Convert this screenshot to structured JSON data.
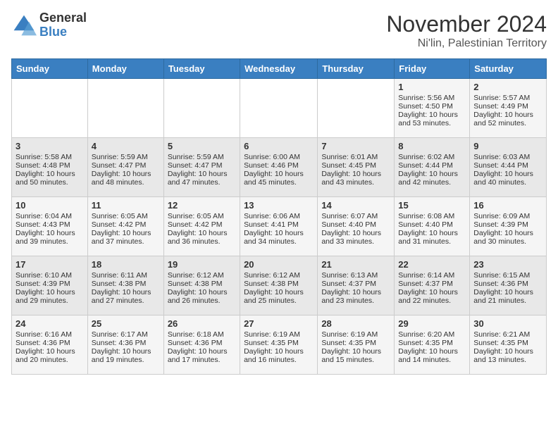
{
  "logo": {
    "general": "General",
    "blue": "Blue"
  },
  "title": "November 2024",
  "subtitle": "Ni'lin, Palestinian Territory",
  "days_of_week": [
    "Sunday",
    "Monday",
    "Tuesday",
    "Wednesday",
    "Thursday",
    "Friday",
    "Saturday"
  ],
  "weeks": [
    [
      {
        "day": "",
        "content": ""
      },
      {
        "day": "",
        "content": ""
      },
      {
        "day": "",
        "content": ""
      },
      {
        "day": "",
        "content": ""
      },
      {
        "day": "",
        "content": ""
      },
      {
        "day": "1",
        "content": "Sunrise: 5:56 AM\nSunset: 4:50 PM\nDaylight: 10 hours and 53 minutes."
      },
      {
        "day": "2",
        "content": "Sunrise: 5:57 AM\nSunset: 4:49 PM\nDaylight: 10 hours and 52 minutes."
      }
    ],
    [
      {
        "day": "3",
        "content": "Sunrise: 5:58 AM\nSunset: 4:48 PM\nDaylight: 10 hours and 50 minutes."
      },
      {
        "day": "4",
        "content": "Sunrise: 5:59 AM\nSunset: 4:47 PM\nDaylight: 10 hours and 48 minutes."
      },
      {
        "day": "5",
        "content": "Sunrise: 5:59 AM\nSunset: 4:47 PM\nDaylight: 10 hours and 47 minutes."
      },
      {
        "day": "6",
        "content": "Sunrise: 6:00 AM\nSunset: 4:46 PM\nDaylight: 10 hours and 45 minutes."
      },
      {
        "day": "7",
        "content": "Sunrise: 6:01 AM\nSunset: 4:45 PM\nDaylight: 10 hours and 43 minutes."
      },
      {
        "day": "8",
        "content": "Sunrise: 6:02 AM\nSunset: 4:44 PM\nDaylight: 10 hours and 42 minutes."
      },
      {
        "day": "9",
        "content": "Sunrise: 6:03 AM\nSunset: 4:44 PM\nDaylight: 10 hours and 40 minutes."
      }
    ],
    [
      {
        "day": "10",
        "content": "Sunrise: 6:04 AM\nSunset: 4:43 PM\nDaylight: 10 hours and 39 minutes."
      },
      {
        "day": "11",
        "content": "Sunrise: 6:05 AM\nSunset: 4:42 PM\nDaylight: 10 hours and 37 minutes."
      },
      {
        "day": "12",
        "content": "Sunrise: 6:05 AM\nSunset: 4:42 PM\nDaylight: 10 hours and 36 minutes."
      },
      {
        "day": "13",
        "content": "Sunrise: 6:06 AM\nSunset: 4:41 PM\nDaylight: 10 hours and 34 minutes."
      },
      {
        "day": "14",
        "content": "Sunrise: 6:07 AM\nSunset: 4:40 PM\nDaylight: 10 hours and 33 minutes."
      },
      {
        "day": "15",
        "content": "Sunrise: 6:08 AM\nSunset: 4:40 PM\nDaylight: 10 hours and 31 minutes."
      },
      {
        "day": "16",
        "content": "Sunrise: 6:09 AM\nSunset: 4:39 PM\nDaylight: 10 hours and 30 minutes."
      }
    ],
    [
      {
        "day": "17",
        "content": "Sunrise: 6:10 AM\nSunset: 4:39 PM\nDaylight: 10 hours and 29 minutes."
      },
      {
        "day": "18",
        "content": "Sunrise: 6:11 AM\nSunset: 4:38 PM\nDaylight: 10 hours and 27 minutes."
      },
      {
        "day": "19",
        "content": "Sunrise: 6:12 AM\nSunset: 4:38 PM\nDaylight: 10 hours and 26 minutes."
      },
      {
        "day": "20",
        "content": "Sunrise: 6:12 AM\nSunset: 4:38 PM\nDaylight: 10 hours and 25 minutes."
      },
      {
        "day": "21",
        "content": "Sunrise: 6:13 AM\nSunset: 4:37 PM\nDaylight: 10 hours and 23 minutes."
      },
      {
        "day": "22",
        "content": "Sunrise: 6:14 AM\nSunset: 4:37 PM\nDaylight: 10 hours and 22 minutes."
      },
      {
        "day": "23",
        "content": "Sunrise: 6:15 AM\nSunset: 4:36 PM\nDaylight: 10 hours and 21 minutes."
      }
    ],
    [
      {
        "day": "24",
        "content": "Sunrise: 6:16 AM\nSunset: 4:36 PM\nDaylight: 10 hours and 20 minutes."
      },
      {
        "day": "25",
        "content": "Sunrise: 6:17 AM\nSunset: 4:36 PM\nDaylight: 10 hours and 19 minutes."
      },
      {
        "day": "26",
        "content": "Sunrise: 6:18 AM\nSunset: 4:36 PM\nDaylight: 10 hours and 17 minutes."
      },
      {
        "day": "27",
        "content": "Sunrise: 6:19 AM\nSunset: 4:35 PM\nDaylight: 10 hours and 16 minutes."
      },
      {
        "day": "28",
        "content": "Sunrise: 6:19 AM\nSunset: 4:35 PM\nDaylight: 10 hours and 15 minutes."
      },
      {
        "day": "29",
        "content": "Sunrise: 6:20 AM\nSunset: 4:35 PM\nDaylight: 10 hours and 14 minutes."
      },
      {
        "day": "30",
        "content": "Sunrise: 6:21 AM\nSunset: 4:35 PM\nDaylight: 10 hours and 13 minutes."
      }
    ]
  ],
  "colors": {
    "header_bg": "#3a7fc1",
    "odd_row": "#f5f5f5",
    "even_row": "#e8e8e8"
  }
}
